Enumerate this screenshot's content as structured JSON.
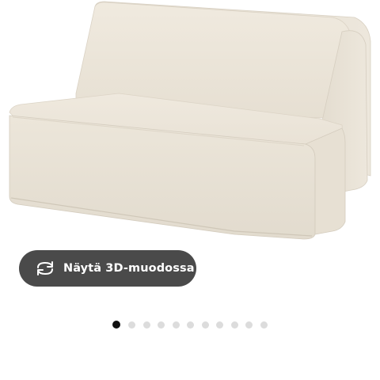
{
  "product": {
    "image_alt": "LYCKSELE sofa bed, beige fabric",
    "view_3d_label": "Näytä 3D-muodossa",
    "view_3d_icon": "rotate-3d-icon"
  },
  "carousel": {
    "total_images": 11,
    "active_index": 0
  },
  "colors": {
    "button_bg": "#4a4a4a",
    "dot_active": "#111111",
    "dot_inactive": "#dcdcdc",
    "sofa_fabric": "#ede6d9"
  }
}
